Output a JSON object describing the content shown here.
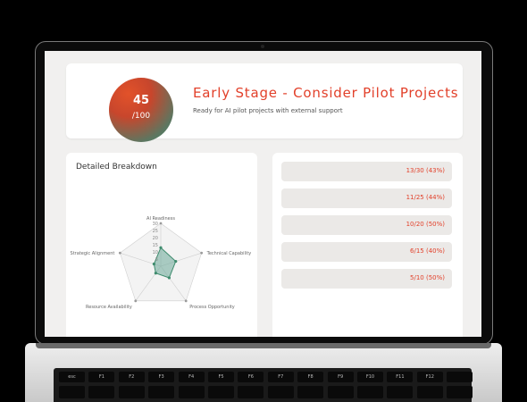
{
  "score": {
    "value": "45",
    "max": "/100",
    "title": "Early Stage - Consider Pilot Projects",
    "subtitle": "Ready for AI pilot projects with external support",
    "gradient": [
      "#e2522a",
      "#3f8c6e"
    ]
  },
  "breakdown": {
    "title": "Detailed Breakdown"
  },
  "chart_data": {
    "type": "radar",
    "categories": [
      "AI Readiness",
      "Technical Capability",
      "Process Opportunity",
      "Resource Availability",
      "Strategic Alignment"
    ],
    "values": [
      13,
      11,
      10,
      6,
      5
    ],
    "tick_labels": [
      "5",
      "10",
      "15",
      "20",
      "25",
      "30"
    ],
    "range": [
      0,
      30
    ],
    "colors": {
      "fill": "#6aa898",
      "stroke": "#3f8c6e",
      "grid": "#cfcfcf"
    }
  },
  "bars": [
    {
      "label": "13/30 (43%)",
      "fraction": 0.43
    },
    {
      "label": "11/25 (44%)",
      "fraction": 0.44
    },
    {
      "label": "10/20 (50%)",
      "fraction": 0.5
    },
    {
      "label": "6/15 (40%)",
      "fraction": 0.4
    },
    {
      "label": "5/10 (50%)",
      "fraction": 0.5
    }
  ],
  "keyboard": {
    "keys": [
      "esc",
      "F1",
      "F2",
      "F3",
      "F4",
      "F5",
      "F6",
      "F7",
      "F8",
      "F9",
      "F10",
      "F11",
      "F12",
      ""
    ]
  },
  "colors": {
    "accent": "#e2402a",
    "background": "#f1f0ef"
  }
}
